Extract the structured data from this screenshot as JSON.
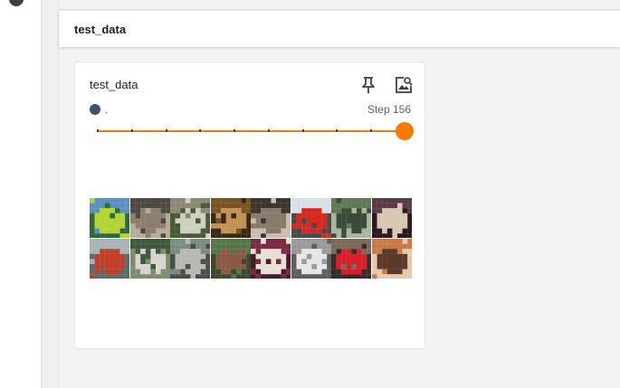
{
  "group": {
    "title": "test_data"
  },
  "card": {
    "title": "test_data",
    "run": {
      "label": ".",
      "color": "#425066"
    },
    "step_label": "Step 156",
    "slider": {
      "value_fraction": 1.0,
      "tick_count": 9,
      "accent": "#f57c00"
    },
    "icons": {
      "pin": "pin-icon",
      "image": "image-search-icon"
    },
    "images": [
      {
        "name": "thumb-green-truck",
        "c": [
          "#5a8fc4",
          "#b4d334",
          "#2e6a3a"
        ]
      },
      {
        "name": "thumb-frog",
        "c": [
          "#4d4a44",
          "#8c7f6e",
          "#b5ab98"
        ]
      },
      {
        "name": "thumb-airplane",
        "c": [
          "#8d8876",
          "#cfd0c2",
          "#4a5a38"
        ]
      },
      {
        "name": "thumb-frog-orange",
        "c": [
          "#7a5524",
          "#c39450",
          "#3a2a15"
        ]
      },
      {
        "name": "thumb-ship",
        "c": [
          "#3d3530",
          "#8a7a6c",
          "#c9bfae"
        ]
      },
      {
        "name": "thumb-red-truck",
        "c": [
          "#d7e0e8",
          "#d32a22",
          "#4a4a4a"
        ]
      },
      {
        "name": "thumb-green-truck-2",
        "c": [
          "#5f7a55",
          "#3b4a3a",
          "#a9b59c"
        ]
      },
      {
        "name": "thumb-horse",
        "c": [
          "#5a3a45",
          "#d8c7b1",
          "#2a1a22"
        ]
      },
      {
        "name": "thumb-boat",
        "c": [
          "#a9b4b8",
          "#c0412a",
          "#5a6a70"
        ]
      },
      {
        "name": "thumb-horse-2",
        "c": [
          "#3f5a3a",
          "#d6d6cf",
          "#7f8c6e"
        ]
      },
      {
        "name": "thumb-car",
        "c": [
          "#7a8d7e",
          "#b8b9b3",
          "#4a4f4a"
        ]
      },
      {
        "name": "thumb-deer",
        "c": [
          "#54764a",
          "#8a5a44",
          "#3a4a2e"
        ]
      },
      {
        "name": "thumb-dog",
        "c": [
          "#7a2a44",
          "#e8e0d4",
          "#4a1a2a"
        ]
      },
      {
        "name": "thumb-truck-white",
        "c": [
          "#9a9a9a",
          "#e6e6e6",
          "#5e5e5e"
        ]
      },
      {
        "name": "thumb-red-car",
        "c": [
          "#7a6a5a",
          "#d8202a",
          "#3a2a2a"
        ]
      },
      {
        "name": "thumb-cat",
        "c": [
          "#c97a4a",
          "#5a3a2a",
          "#e8c8a8"
        ]
      }
    ]
  }
}
